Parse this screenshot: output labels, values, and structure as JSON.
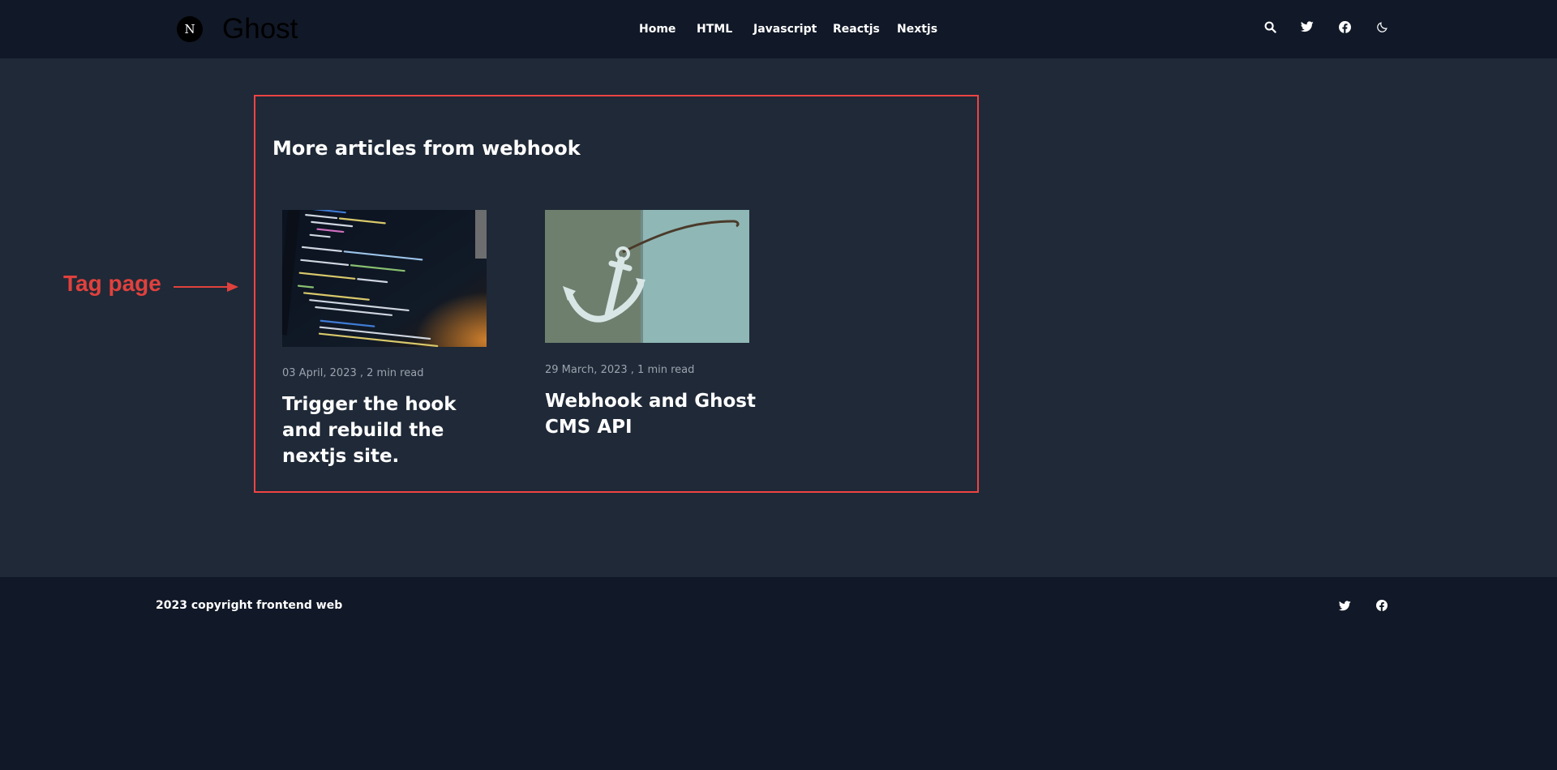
{
  "header": {
    "logo_letter": "N",
    "site_title": "Ghost",
    "nav": [
      "Home",
      "HTML",
      "Javascript",
      "Reactjs",
      "Nextjs"
    ],
    "icons": [
      "search-icon",
      "twitter-icon",
      "facebook-icon",
      "moon-icon"
    ]
  },
  "annotation": {
    "label": "Tag page",
    "color": "#e0413d"
  },
  "main": {
    "section_title": "More articles from webhook",
    "articles": [
      {
        "meta": "03 April, 2023 , 2 min read",
        "title": "Trigger the hook and rebuild the nextjs site.",
        "image": "code-editor-photo"
      },
      {
        "meta": "29 March, 2023 , 1 min read",
        "title": "Webhook and Ghost CMS API",
        "image": "anchor-photo"
      }
    ]
  },
  "footer": {
    "copyright": "2023 copyright frontend web",
    "icons": [
      "twitter-icon",
      "facebook-icon"
    ]
  },
  "colors": {
    "header_bg": "#111827",
    "main_bg": "#1f2937",
    "frame_border": "#ef4444",
    "meta_text": "#9ca3af"
  }
}
